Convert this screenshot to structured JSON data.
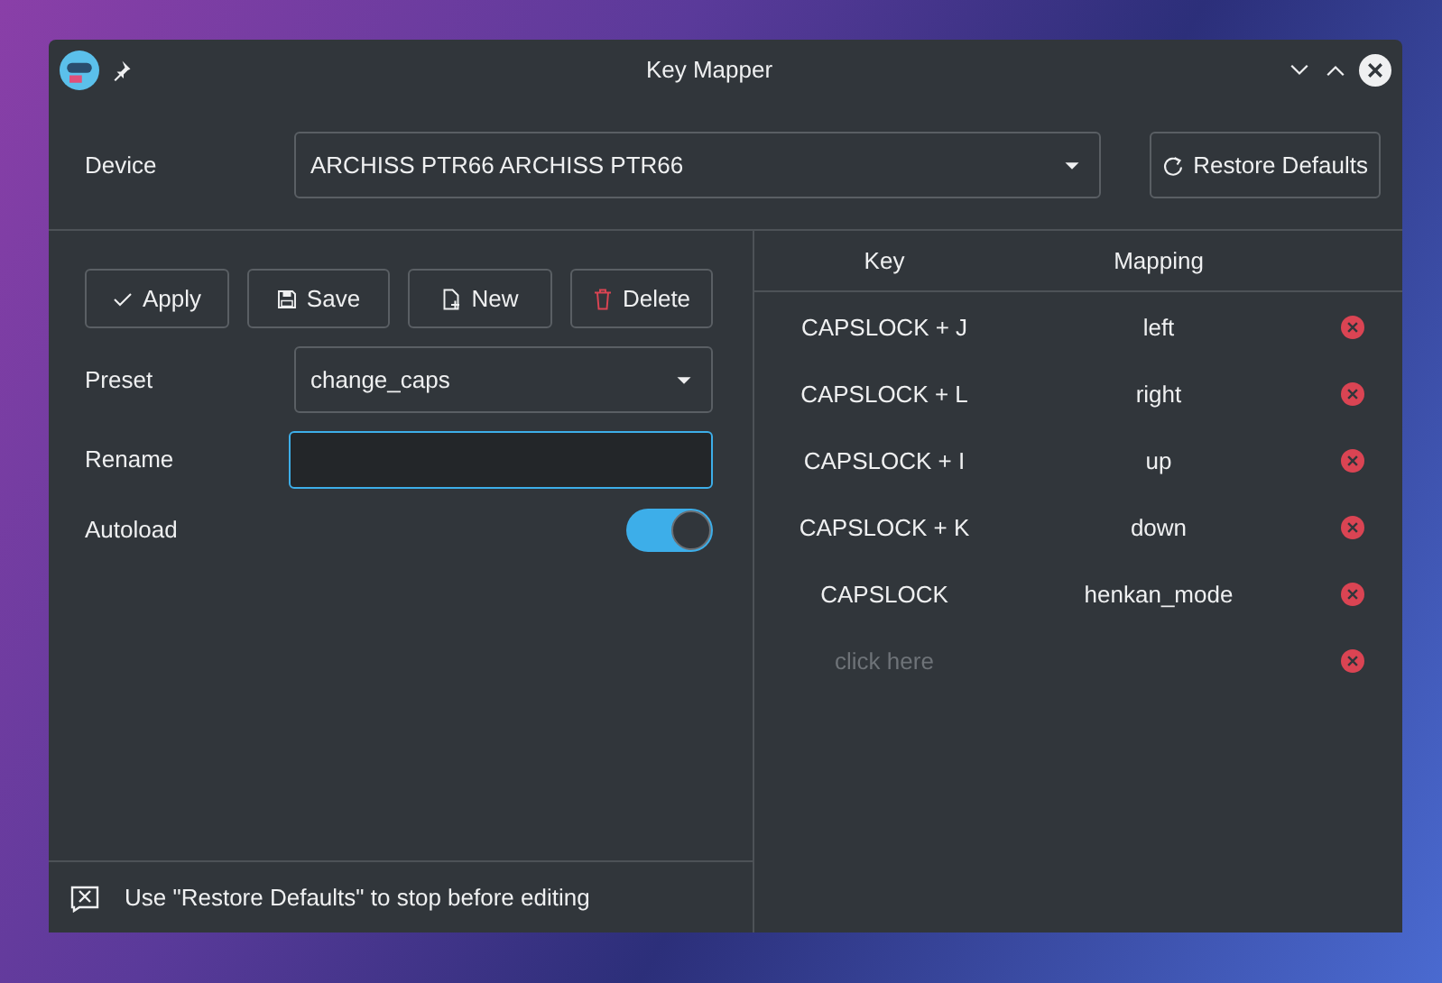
{
  "window": {
    "title": "Key Mapper"
  },
  "device": {
    "label": "Device",
    "value": "ARCHISS PTR66 ARCHISS PTR66",
    "restore_button": "Restore Defaults"
  },
  "toolbar": [
    {
      "label": "Apply",
      "kind": "apply"
    },
    {
      "label": "Save",
      "kind": "save"
    },
    {
      "label": "New",
      "kind": "new"
    },
    {
      "label": "Delete",
      "kind": "delete"
    }
  ],
  "preset": {
    "label": "Preset",
    "value": "change_caps"
  },
  "rename": {
    "label": "Rename",
    "focused": true
  },
  "autoload": {
    "label": "Autoload",
    "on": true
  },
  "table": {
    "columns": [
      "Key",
      "Mapping"
    ],
    "rows": [
      {
        "key": "CAPSLOCK + J",
        "mapping": "left",
        "kind": "mapping"
      },
      {
        "key": "CAPSLOCK + L",
        "mapping": "right",
        "kind": "mapping"
      },
      {
        "key": "CAPSLOCK + I",
        "mapping": "up",
        "kind": "mapping"
      },
      {
        "key": "CAPSLOCK + K",
        "mapping": "down",
        "kind": "mapping"
      },
      {
        "key": "CAPSLOCK",
        "mapping": "henkan_mode",
        "kind": "mapping"
      },
      {
        "key": "click here",
        "kind": "placeholder"
      }
    ]
  },
  "status_bar": {
    "text": "Use \"Restore Defaults\" to stop before editing"
  }
}
